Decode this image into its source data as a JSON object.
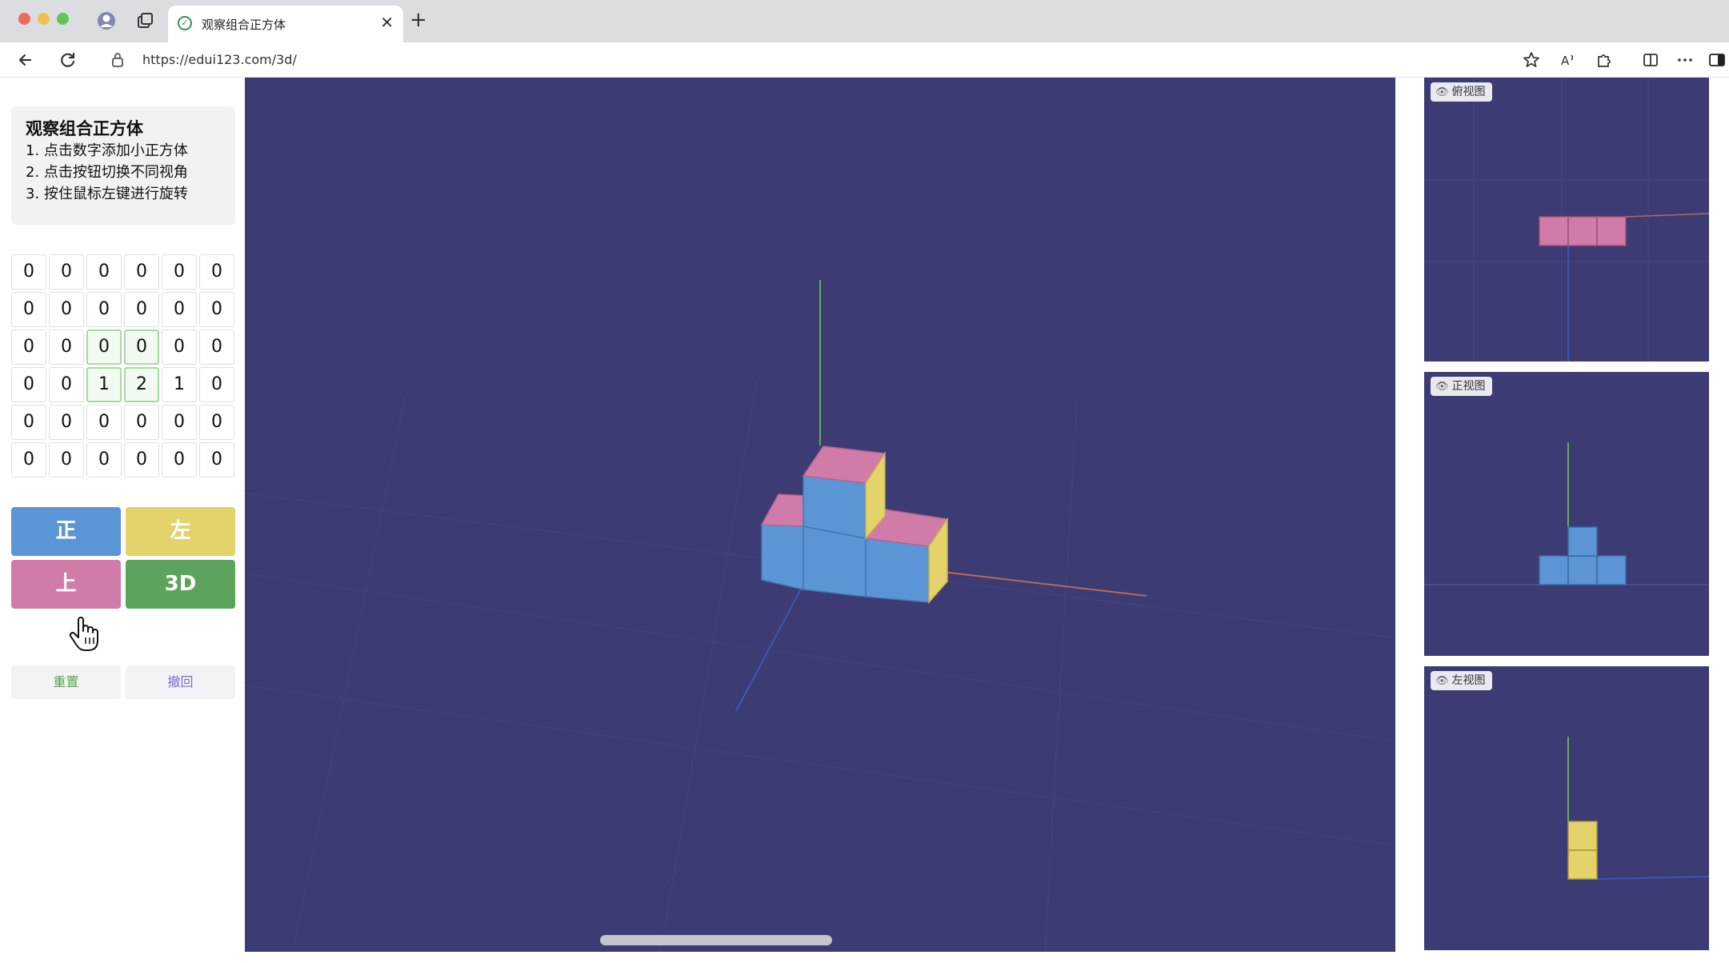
{
  "browser": {
    "tab_title": "观察组合正方体",
    "url": "https://edui123.com/3d/",
    "new_tab": "+",
    "close": "✕"
  },
  "instructions": {
    "title": "观察组合正方体",
    "steps": [
      "1. 点击数字添加小正方体",
      "2. 点击按钮切换不同视角",
      "3. 按住鼠标左键进行旋转"
    ]
  },
  "grid": [
    [
      "0",
      "0",
      "0",
      "0",
      "0",
      "0"
    ],
    [
      "0",
      "0",
      "0",
      "0",
      "0",
      "0"
    ],
    [
      "0",
      "0",
      "0",
      "0",
      "0",
      "0"
    ],
    [
      "0",
      "0",
      "1",
      "2",
      "1",
      "0"
    ],
    [
      "0",
      "0",
      "0",
      "0",
      "0",
      "0"
    ],
    [
      "0",
      "0",
      "0",
      "0",
      "0",
      "0"
    ]
  ],
  "view_buttons": {
    "front": "正",
    "left": "左",
    "top": "上",
    "three_d": "3D"
  },
  "actions": {
    "reset": "重置",
    "undo": "撤回"
  },
  "side_views": {
    "top": "俯视图",
    "front": "正视图",
    "left": "左视图"
  },
  "colors": {
    "background": "#3d3b73",
    "cube_front": "#5b95d6",
    "cube_top": "#d17ca8",
    "cube_side": "#e4d36a",
    "axis_y": "#5fae5a",
    "axis_x": "#b56a5a",
    "axis_z": "#3d55b5"
  }
}
